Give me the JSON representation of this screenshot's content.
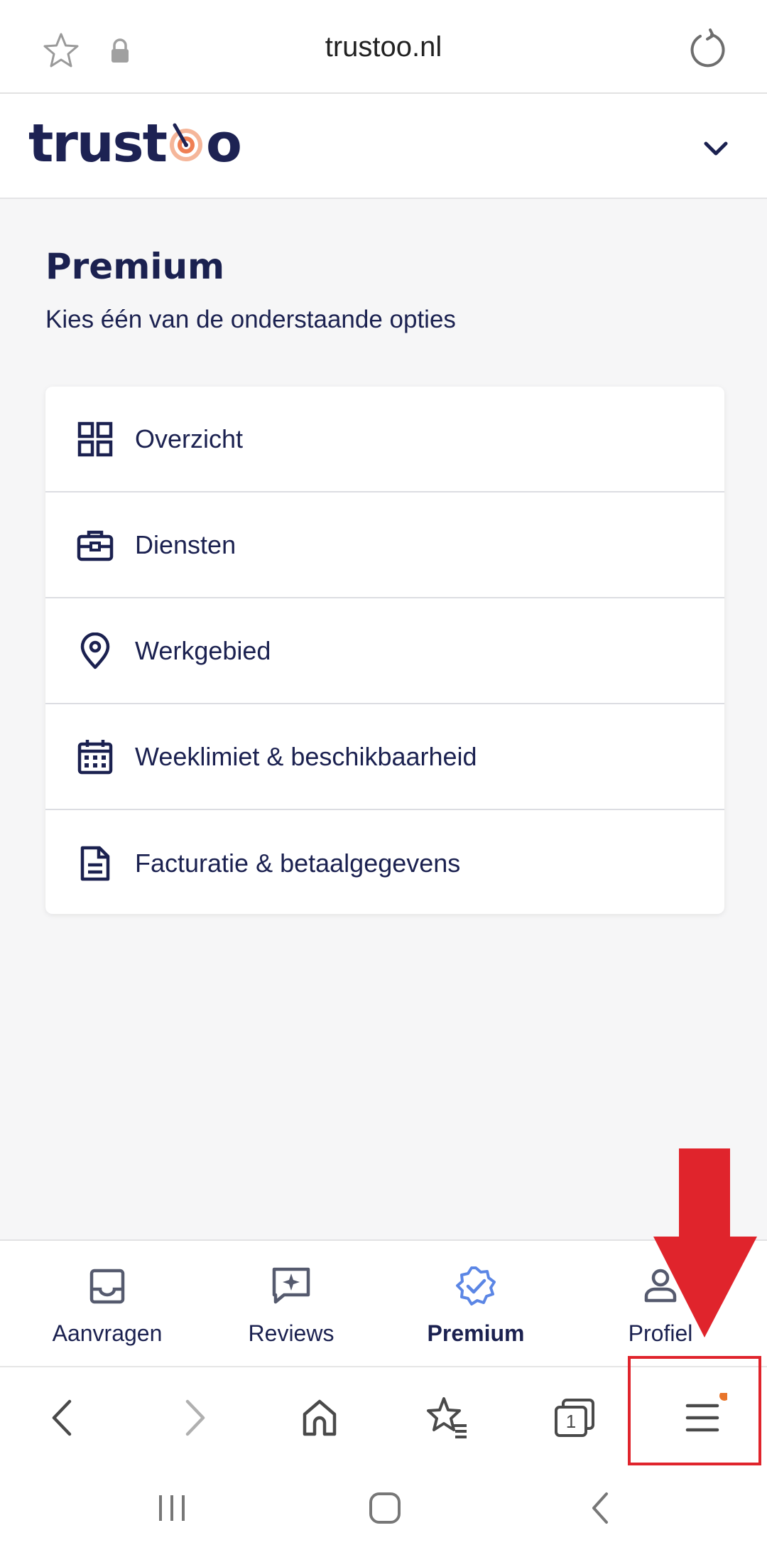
{
  "browser": {
    "url": "trustoo.nl",
    "icons": [
      "star-icon",
      "lock-icon",
      "reload-icon"
    ]
  },
  "site": {
    "logo": {
      "part1": "trust",
      "part2": "o"
    },
    "brand_color": "#1d2253",
    "accent_color": "#f08a5d"
  },
  "page": {
    "title": "Premium",
    "subtitle": "Kies één van de onderstaande opties"
  },
  "menu": {
    "items": [
      {
        "label": "Overzicht",
        "icon": "grid-icon"
      },
      {
        "label": "Diensten",
        "icon": "briefcase-icon"
      },
      {
        "label": "Werkgebied",
        "icon": "location-pin-icon"
      },
      {
        "label": "Weeklimiet & beschikbaarheid",
        "icon": "calendar-icon"
      },
      {
        "label": "Facturatie & betaalgegevens",
        "icon": "document-icon"
      }
    ]
  },
  "tabbar": {
    "tabs": [
      {
        "label": "Aanvragen",
        "icon": "inbox-icon",
        "active": false
      },
      {
        "label": "Reviews",
        "icon": "review-icon",
        "active": false
      },
      {
        "label": "Premium",
        "icon": "verified-badge-icon",
        "active": true
      },
      {
        "label": "Profiel",
        "icon": "user-icon",
        "active": false
      }
    ],
    "active_color": "#5b86e5"
  },
  "browser_toolbar": {
    "tab_count": "1",
    "icons": [
      "back-icon",
      "forward-icon",
      "home-icon",
      "bookmarks-icon",
      "tabs-icon",
      "menu-icon"
    ],
    "notification_dot_color": "#e8742a"
  },
  "annotation": {
    "color": "#e0242c"
  }
}
